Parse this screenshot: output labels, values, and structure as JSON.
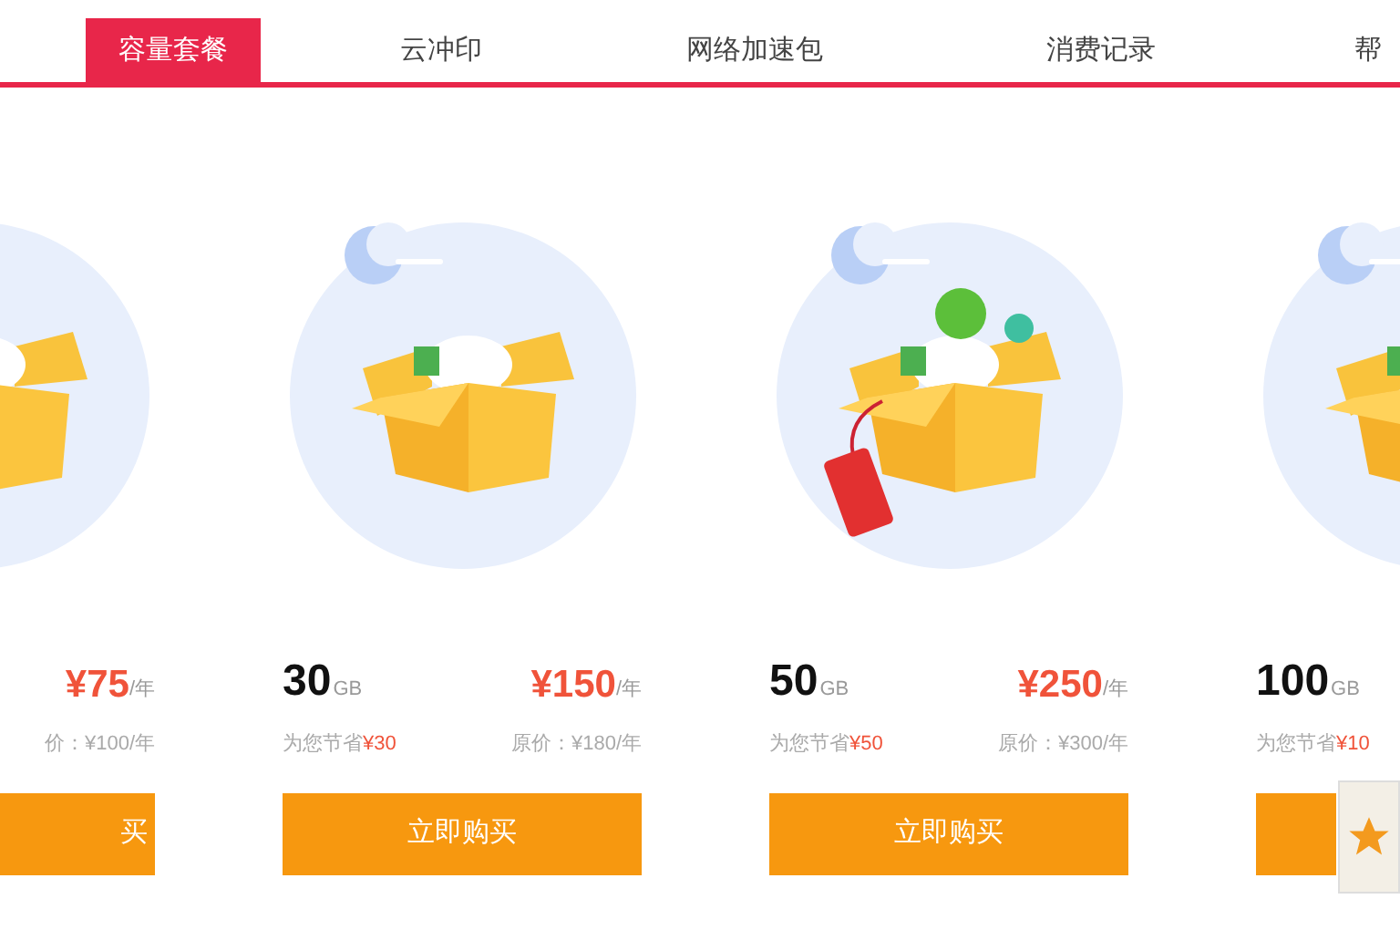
{
  "tabs": [
    {
      "label": "容量套餐",
      "selected": true
    },
    {
      "label": "云冲印",
      "selected": false
    },
    {
      "label": "网络加速包",
      "selected": false
    },
    {
      "label": "消费记录",
      "selected": false
    },
    {
      "label": "帮",
      "selected": false
    }
  ],
  "plans": [
    {
      "kind": "partial",
      "tagged": false,
      "price": "¥75",
      "per": "/年",
      "original": "价：¥100/年",
      "button": "买"
    },
    {
      "kind": "full",
      "tagged": false,
      "capacity": "30",
      "unit": "GB",
      "price": "¥150",
      "per": "/年",
      "savings": "为您节省",
      "savings_amount": "¥30",
      "original": "原价：¥180/年",
      "button": "立即购买"
    },
    {
      "kind": "full",
      "tagged": true,
      "capacity": "50",
      "unit": "GB",
      "price": "¥250",
      "per": "/年",
      "savings": "为您节省",
      "savings_amount": "¥50",
      "original": "原价：¥300/年",
      "button": "立即购买"
    },
    {
      "kind": "clipped",
      "tagged": false,
      "capacity": "100",
      "unit": "GB",
      "savings": "为您节省",
      "savings_amount": "¥10"
    }
  ]
}
